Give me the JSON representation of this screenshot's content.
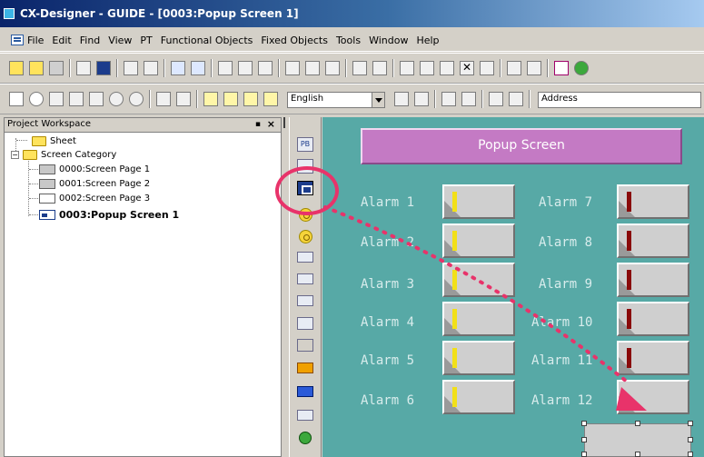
{
  "window": {
    "title": "CX-Designer - GUIDE - [0003:Popup Screen 1]"
  },
  "menu": [
    "File",
    "Edit",
    "Find",
    "View",
    "PT",
    "Functional Objects",
    "Fixed Objects",
    "Tools",
    "Window",
    "Help"
  ],
  "toolbar": {
    "language_value": "English",
    "address_value": "Address"
  },
  "workspace": {
    "title": "Project Workspace",
    "pin_label": "▪",
    "close_label": "×",
    "tree": {
      "sheet": "Sheet",
      "screen_category": "Screen Category",
      "pages": [
        "0000:Screen Page 1",
        "0001:Screen Page 2",
        "0002:Screen Page 3",
        "0003:Popup Screen 1"
      ]
    }
  },
  "canvas": {
    "banner": "Popup Screen",
    "alarms_left": [
      "Alarm 1",
      "Alarm 2",
      "Alarm 3",
      "Alarm 4",
      "Alarm 5",
      "Alarm 6"
    ],
    "alarms_right": [
      "Alarm 7",
      "Alarm 8",
      "Alarm 9",
      "Alarm 10",
      "Alarm 11",
      "Alarm 12"
    ],
    "lamp_colors": {
      "left": "#f2e018",
      "right": "#8a0a0a"
    }
  },
  "annotation": {
    "ring_color": "#e8336a",
    "arrow_color": "#e8336a"
  },
  "palette_icons": [
    "pt-icon",
    "rectangle-icon",
    "lamp-button-icon",
    "circle-lamp-icon",
    "word-lamp-icon",
    "numeral-display-icon",
    "string-display-icon",
    "data-block-icon",
    "list-icon",
    "thumbwheel-icon",
    "orange-object-icon",
    "bar-graph-icon",
    "broken-line-icon",
    "green-object-icon"
  ]
}
